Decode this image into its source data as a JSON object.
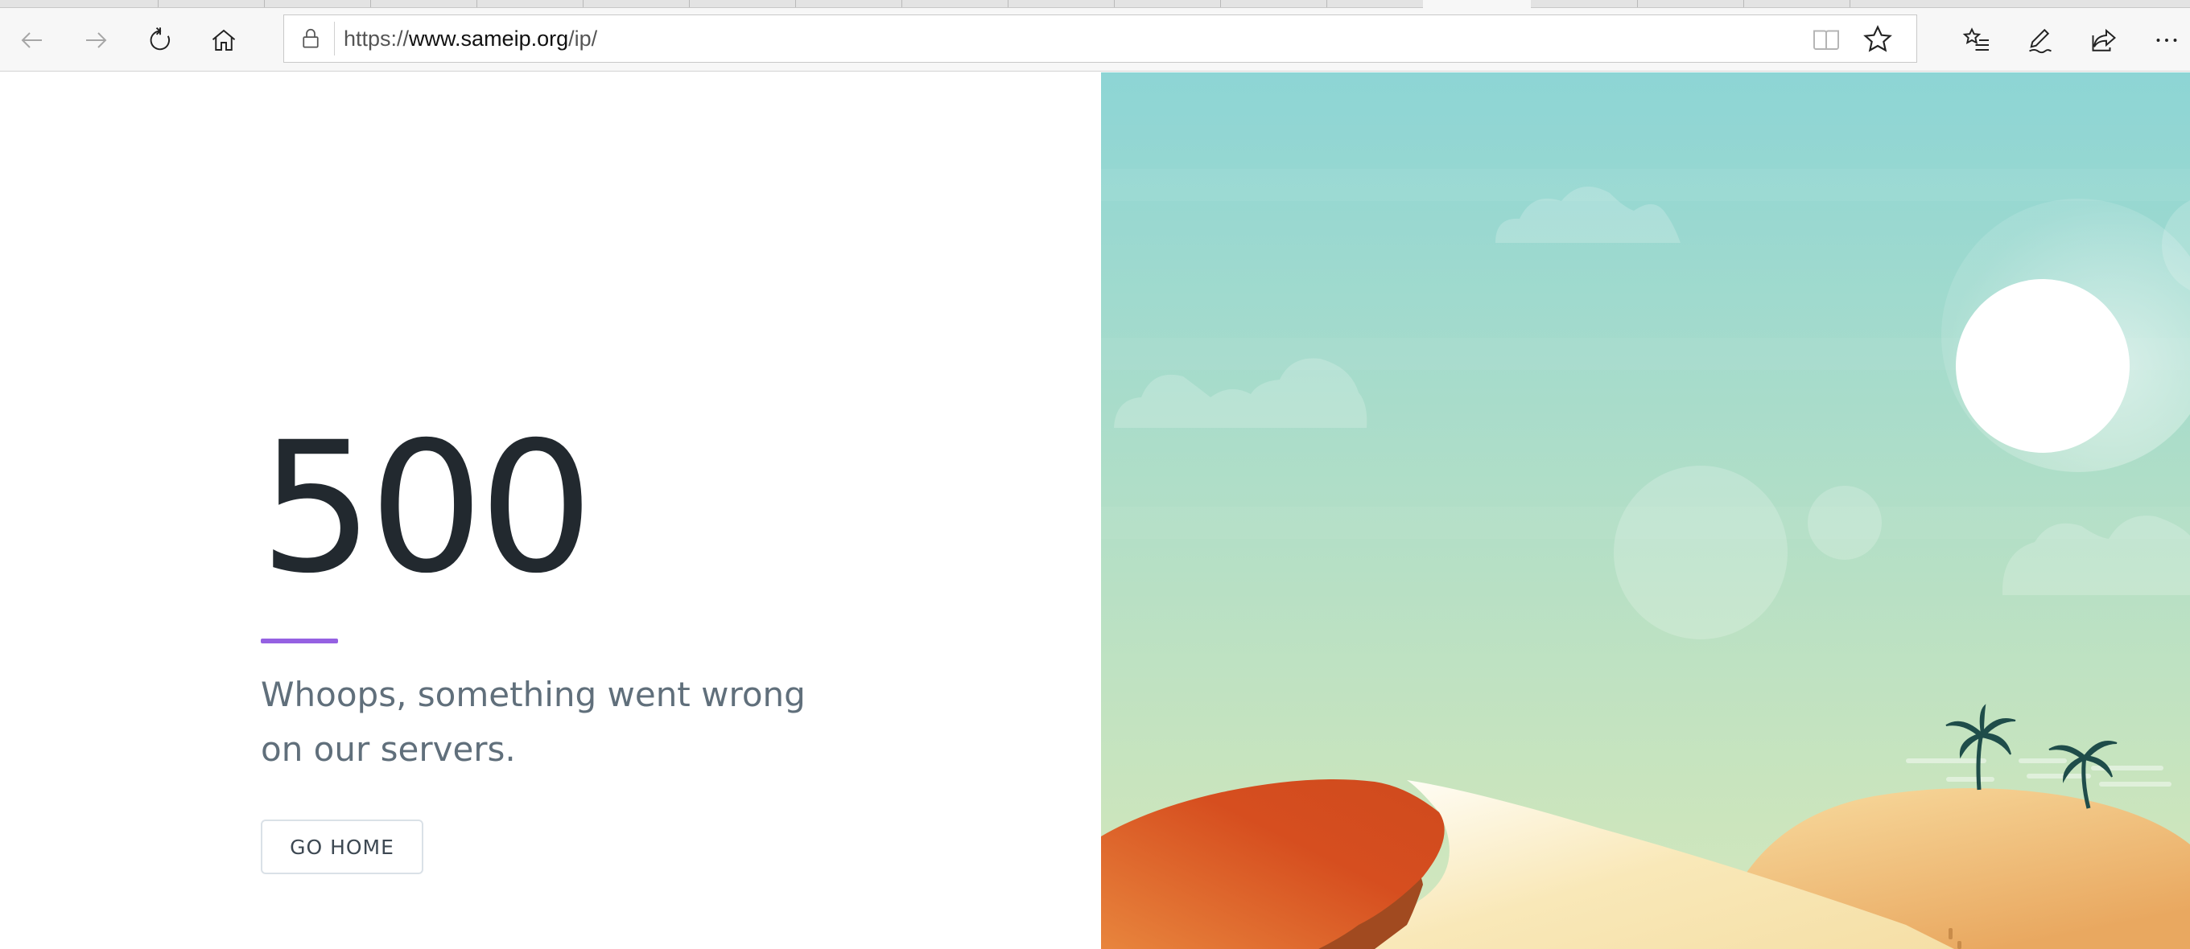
{
  "browser": {
    "url_prefix": "https://",
    "url_host": "www.sameip.org",
    "url_path": "/ip/",
    "icons": {
      "back": "back-arrow-icon",
      "forward": "forward-arrow-icon",
      "refresh": "refresh-icon",
      "home": "home-icon",
      "lock": "lock-icon",
      "reading_view": "reading-view-icon",
      "favorite": "star-icon",
      "favorites_hub": "favorites-list-icon",
      "notes": "pen-icon",
      "share": "share-icon",
      "more": "more-icon"
    }
  },
  "error_page": {
    "code": "500",
    "message": "Whoops, something went wrong on our servers.",
    "button_label": "GO HOME",
    "accent_color": "#9561e2"
  },
  "illustration": {
    "sky_top": "#8dd5d5",
    "sky_bottom": "#cbe5bd",
    "sun": "#ffffff",
    "dune_red": "#d64e1f",
    "dune_sand": "#f8e6b2",
    "palm": "#1f4d4a"
  }
}
